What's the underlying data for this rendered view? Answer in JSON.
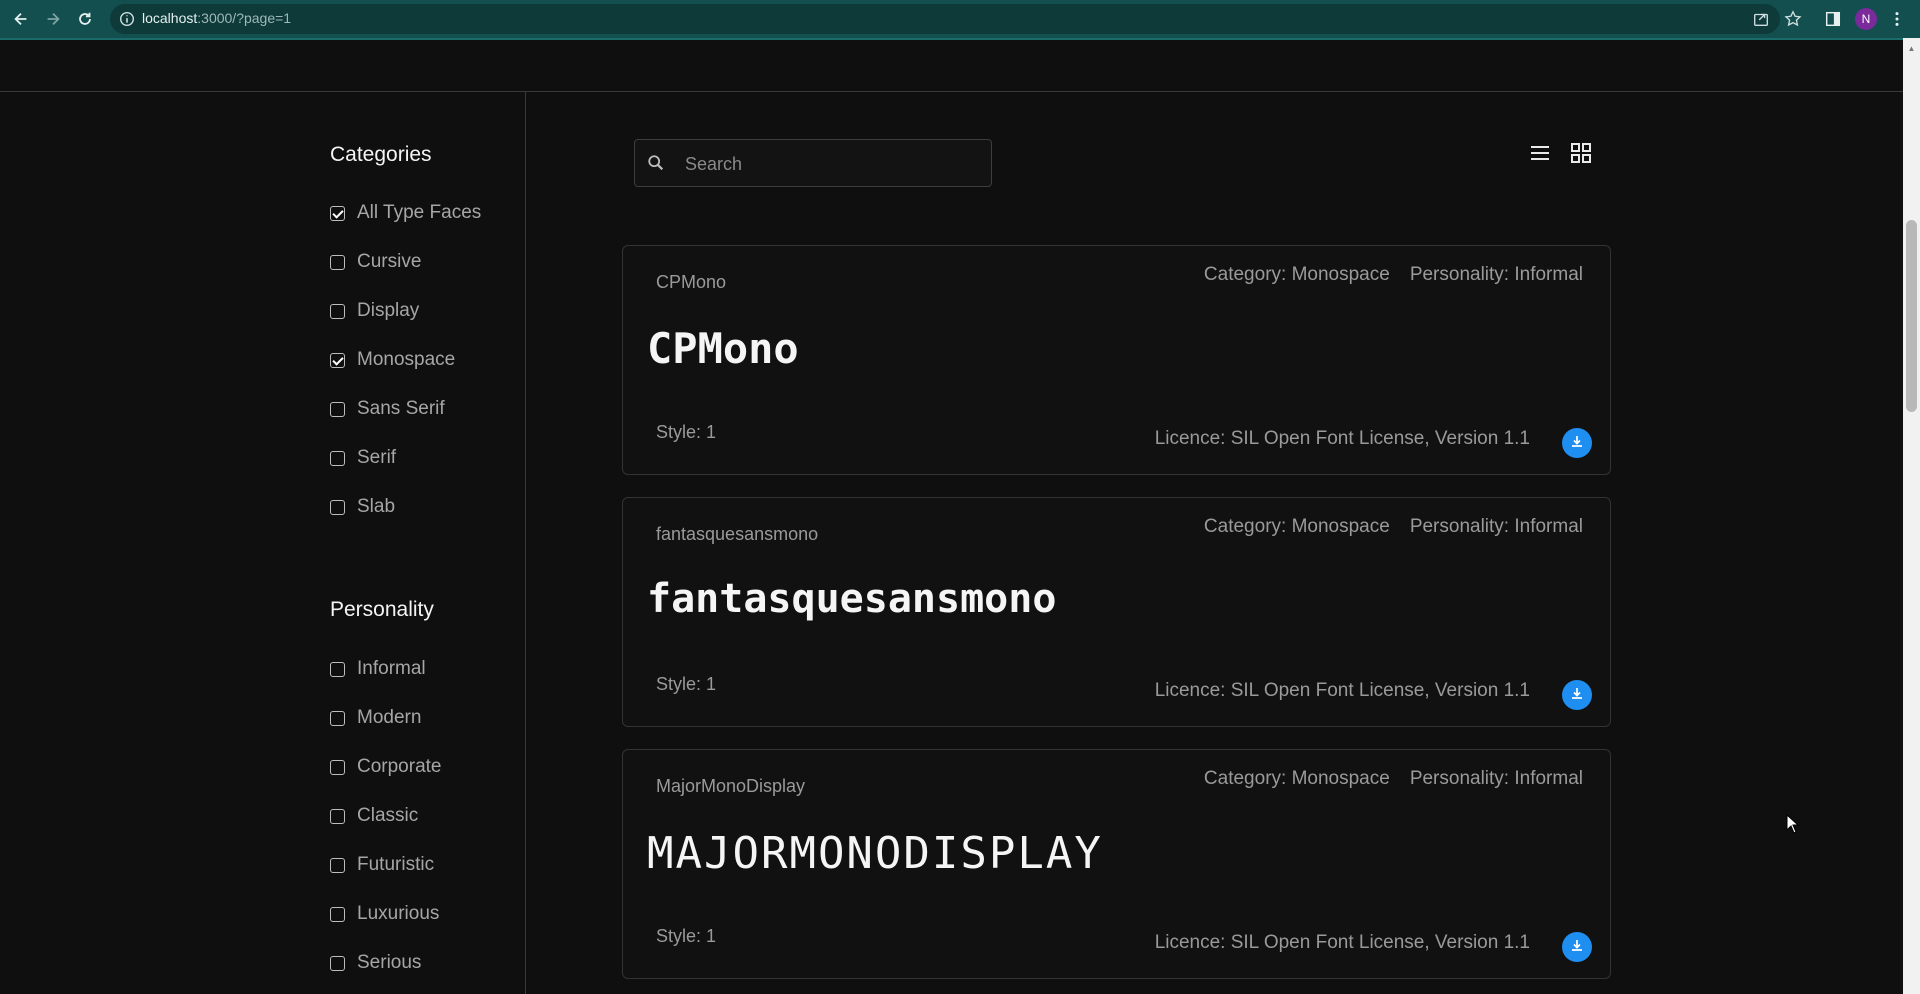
{
  "browser": {
    "url_host": "localhost",
    "url_rest": ":3000/?page=1",
    "avatar_letter": "N",
    "accent": "#134f4f"
  },
  "search": {
    "placeholder": "Search"
  },
  "categories": {
    "title": "Categories",
    "items": [
      {
        "label": "All Type Faces",
        "checked": true
      },
      {
        "label": "Cursive",
        "checked": false
      },
      {
        "label": "Display",
        "checked": false
      },
      {
        "label": "Monospace",
        "checked": true
      },
      {
        "label": "Sans Serif",
        "checked": false
      },
      {
        "label": "Serif",
        "checked": false
      },
      {
        "label": "Slab",
        "checked": false
      }
    ]
  },
  "personality": {
    "title": "Personality",
    "items": [
      {
        "label": "Informal",
        "checked": false
      },
      {
        "label": "Modern",
        "checked": false
      },
      {
        "label": "Corporate",
        "checked": false
      },
      {
        "label": "Classic",
        "checked": false
      },
      {
        "label": "Futuristic",
        "checked": false
      },
      {
        "label": "Luxurious",
        "checked": false
      },
      {
        "label": "Serious",
        "checked": false
      }
    ]
  },
  "fonts": [
    {
      "name": "CPMono",
      "category": "Category: Monospace",
      "personality": "Personality: Informal",
      "preview": "CPMono",
      "style": "Style: 1",
      "licence": "Licence: SIL Open Font License, Version 1.1"
    },
    {
      "name": "fantasquesansmono",
      "category": "Category: Monospace",
      "personality": "Personality: Informal",
      "preview": "fantasquesansmono",
      "style": "Style: 1",
      "licence": "Licence: SIL Open Font License, Version 1.1"
    },
    {
      "name": "MajorMonoDisplay",
      "category": "Category: Monospace",
      "personality": "Personality: Informal",
      "preview": "MAJORMONODISPLAY",
      "style": "Style: 1",
      "licence": "Licence: SIL Open Font License, Version 1.1"
    }
  ]
}
